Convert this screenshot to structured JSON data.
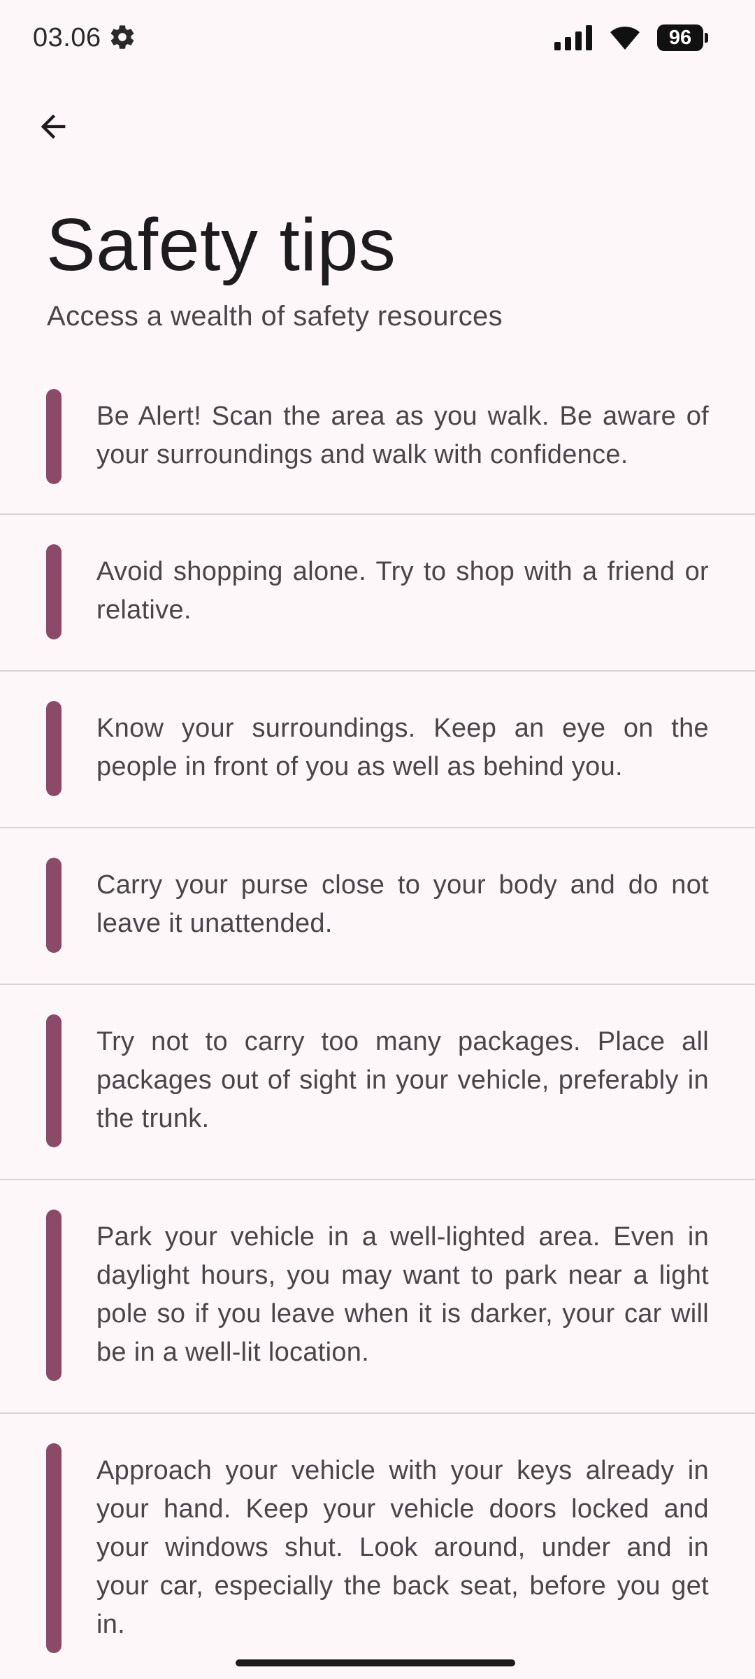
{
  "status_bar": {
    "time": "03.06",
    "battery": "96",
    "icons": [
      "settings-gear-icon",
      "signal-bars-icon",
      "wifi-icon",
      "battery-icon"
    ]
  },
  "header": {
    "back_icon": "arrow-back-icon",
    "title": "Safety tips",
    "subtitle": "Access a wealth of safety resources"
  },
  "colors": {
    "background": "#fdf7fa",
    "accent_bar": "#8b4a68",
    "text_primary": "#1d1b1e",
    "text_secondary": "#4a4549",
    "divider": "#d7d2d6"
  },
  "tips": [
    {
      "text": "Be Alert! Scan the area as you walk. Be aware of your surroundings and walk with confidence."
    },
    {
      "text": "Avoid shopping alone. Try to shop with a friend or relative."
    },
    {
      "text": "Know your surroundings. Keep an eye on the people in front of you as well as behind you."
    },
    {
      "text": "Carry your purse close to your body and do not leave it unattended."
    },
    {
      "text": "Try not to carry too many packages. Place all packages out of sight in your vehicle, preferably in the trunk."
    },
    {
      "text": "Park your vehicle in a well-lighted area. Even in daylight hours, you may want to park near a light pole so if you leave when it is darker, your car will be in a well-lit location."
    },
    {
      "text": "Approach your vehicle with your keys already in your hand. Keep your vehicle doors locked and your windows shut. Look around, under and in your car, especially the back seat, before you get in."
    }
  ]
}
